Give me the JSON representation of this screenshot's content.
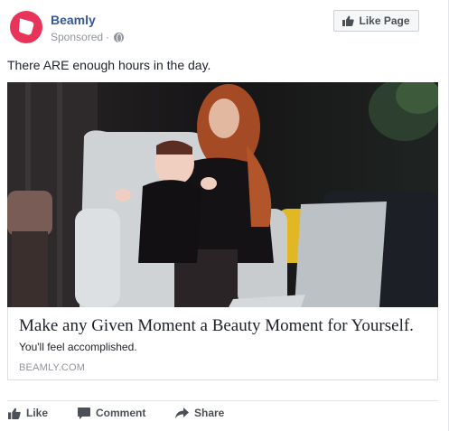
{
  "page": {
    "name": "Beamly",
    "sponsored": "Sponsored",
    "separator": "·"
  },
  "like_page_label": "Like Page",
  "post_text": "There ARE enough hours in the day.",
  "link": {
    "headline": "Make any Given Moment a Beauty Moment for Yourself.",
    "description": "You'll feel accomplished.",
    "domain": "BEAMLY.COM"
  },
  "actions": {
    "like": "Like",
    "comment": "Comment",
    "share": "Share"
  },
  "colors": {
    "brand": "#e8335a",
    "link_blue": "#365899",
    "muted": "#90949c"
  },
  "icons": {
    "avatar": "beamly-logo",
    "globe": "globe-icon",
    "like": "thumbs-up-icon",
    "comment": "comment-icon",
    "share": "share-arrow-icon"
  }
}
